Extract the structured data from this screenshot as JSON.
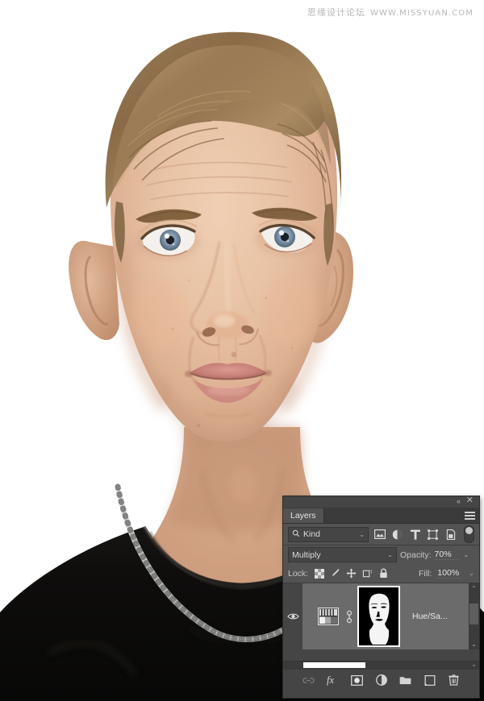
{
  "watermark": {
    "chinese": "思缘设计论坛",
    "url": "WWW.MISSYUAN.COM"
  },
  "photo": {
    "subject": "young-man-portrait-front-facing",
    "background_color": "#ffffff",
    "shirt_color": "#0d0c0c",
    "necklace": "silver-chain"
  },
  "panel": {
    "titlebar": {
      "collapse_icon": "«",
      "close_icon": "✕"
    },
    "tab_label": "Layers",
    "menu_icon": "hamburger-menu-icon",
    "filter": {
      "kind_label": "Kind",
      "search_icon": "magnifier-icon",
      "caret": "⌄",
      "icons": [
        {
          "name": "pixel-layer-filter-icon",
          "title": "Filter for pixel layers"
        },
        {
          "name": "adjustment-layer-filter-icon",
          "title": "Filter for adjustment layers"
        },
        {
          "name": "type-layer-filter-icon",
          "title": "Filter for type layers"
        },
        {
          "name": "shape-layer-filter-icon",
          "title": "Filter for shape layers"
        },
        {
          "name": "smart-object-filter-icon",
          "title": "Filter for smart objects"
        }
      ],
      "toggle_name": "filter-enable-toggle"
    },
    "blend": {
      "mode": "Multiply",
      "caret": "⌄",
      "opacity_label": "Opacity:",
      "opacity_value": "70%",
      "opacity_caret": "⌄"
    },
    "lock": {
      "label": "Lock:",
      "fill_label": "Fill:",
      "fill_value": "100%",
      "fill_caret": "⌄",
      "icons": [
        {
          "name": "lock-transparent-pixels-icon"
        },
        {
          "name": "lock-image-pixels-icon"
        },
        {
          "name": "lock-position-icon"
        },
        {
          "name": "lock-artboard-nesting-icon"
        },
        {
          "name": "lock-all-icon"
        }
      ]
    },
    "layers": [
      {
        "name": "Hue/Sa...",
        "visible": true,
        "selected": true,
        "linked": true,
        "mask_selected": true,
        "thumbnail": "hue-saturation-adjustment-thumbnail",
        "mask_thumbnail": "layer-mask-face-silhouette"
      }
    ],
    "scrollbars": {
      "vertical_up": "⌃",
      "vertical_down": "⌄",
      "horizontal_caret": "⌄"
    },
    "bottom_toolbar": [
      {
        "name": "link-layers-button",
        "glyph": "link-icon",
        "enabled": false
      },
      {
        "name": "layer-style-button",
        "glyph": "fx",
        "enabled": true
      },
      {
        "name": "add-layer-mask-button",
        "glyph": "mask-icon",
        "enabled": true
      },
      {
        "name": "new-adjustment-layer-button",
        "glyph": "half-circle-icon",
        "enabled": true
      },
      {
        "name": "new-group-button",
        "glyph": "folder-icon",
        "enabled": true
      },
      {
        "name": "new-layer-button",
        "glyph": "new-layer-icon",
        "enabled": true
      },
      {
        "name": "delete-layer-button",
        "glyph": "trash-icon",
        "enabled": true
      }
    ]
  },
  "colors": {
    "panel_bg": "#454545",
    "panel_row_bg": "#535353",
    "layer_selected_bg": "#6b6b6b",
    "text": "#d4d4d4",
    "scrollbar_thumb": "#ffffff"
  }
}
